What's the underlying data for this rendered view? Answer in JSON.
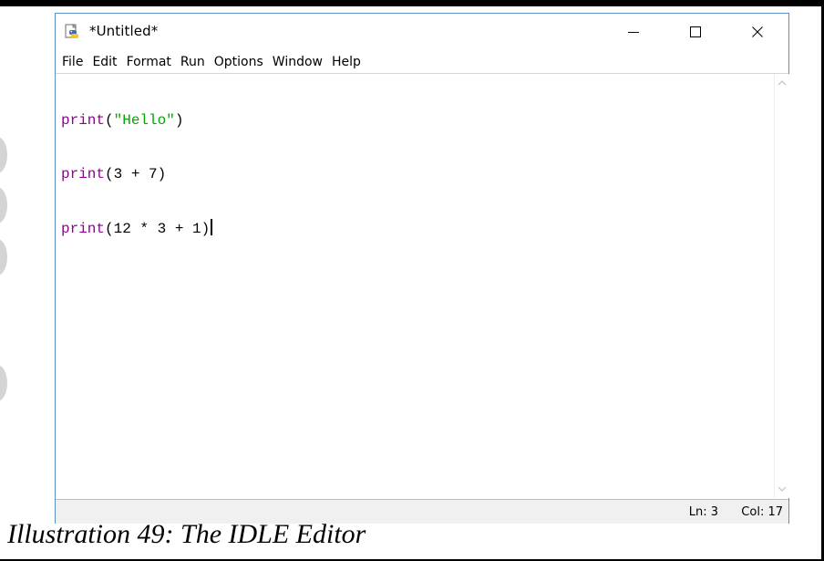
{
  "window": {
    "title": "*Untitled*",
    "icon": "python-file-icon",
    "controls": {
      "minimize": "minimize-icon",
      "maximize": "maximize-icon",
      "close": "close-icon"
    }
  },
  "menu": {
    "items": [
      "File",
      "Edit",
      "Format",
      "Run",
      "Options",
      "Window",
      "Help"
    ]
  },
  "editor": {
    "lines": [
      [
        {
          "t": "print",
          "c": "kw"
        },
        {
          "t": "(",
          "c": "plain"
        },
        {
          "t": "\"Hello\"",
          "c": "str"
        },
        {
          "t": ")",
          "c": "plain"
        }
      ],
      [
        {
          "t": "print",
          "c": "kw"
        },
        {
          "t": "(3 + 7)",
          "c": "plain"
        }
      ],
      [
        {
          "t": "print",
          "c": "kw"
        },
        {
          "t": "(12 * 3 + 1)",
          "c": "plain"
        }
      ]
    ],
    "colors": {
      "keyword": "#900090",
      "string": "#00aa00",
      "text": "#000000"
    }
  },
  "status": {
    "line": "Ln: 3",
    "column": "Col: 17"
  },
  "caption": "Illustration 49: The IDLE Editor"
}
